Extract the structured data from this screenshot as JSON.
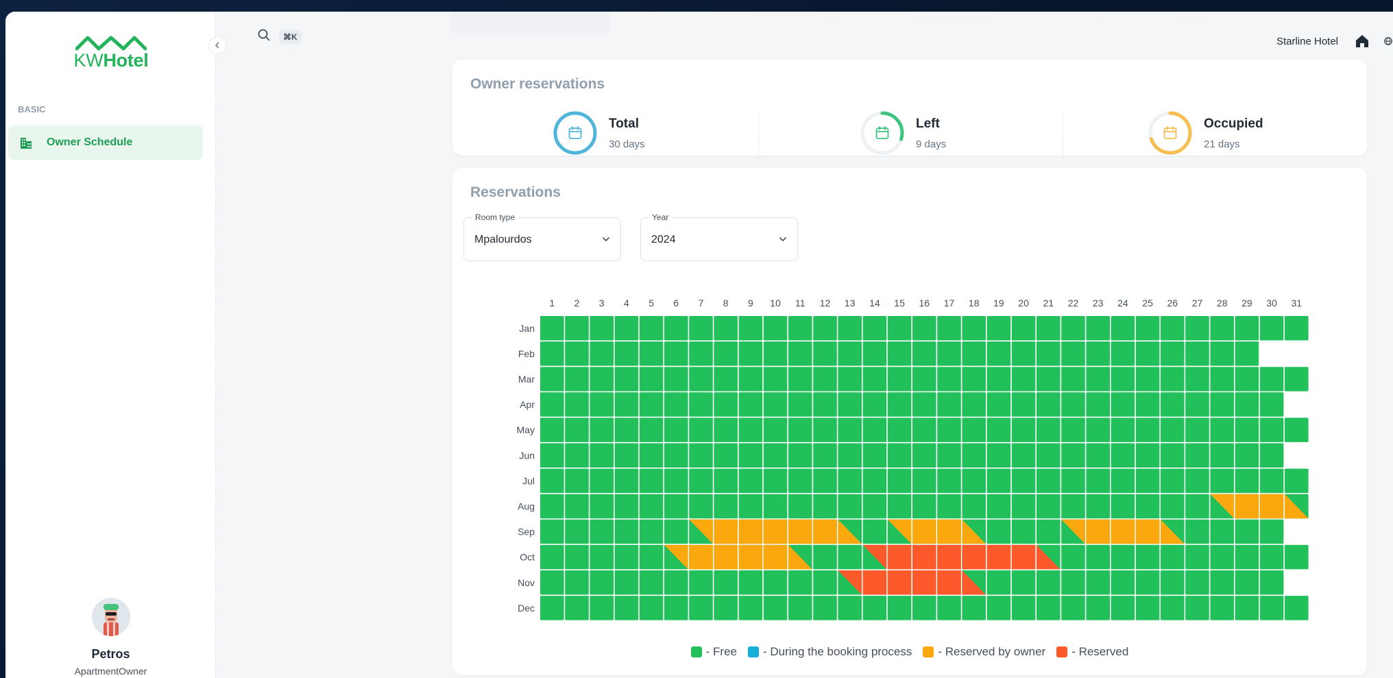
{
  "app": {
    "logo_brand_prefix": "KW",
    "logo_brand_suffix": "Hotel"
  },
  "sidebar": {
    "section_label": "BASIC",
    "items": [
      {
        "label": "Owner Schedule",
        "icon": "building-icon",
        "active": true
      }
    ],
    "collapse_icon": "chevron-left-icon"
  },
  "user": {
    "name": "Petros",
    "role": "ApartmentOwner"
  },
  "topbar": {
    "search_icon": "search-icon",
    "shortcut": "⌘K",
    "hotel_name": "Starline Hotel",
    "home_icon": "home-icon",
    "language_icon": "globe-icon"
  },
  "owner_reservations": {
    "title": "Owner reservations",
    "stats": [
      {
        "label": "Total",
        "value": "30 days",
        "color": "#4fb6d9",
        "progress": 1.0
      },
      {
        "label": "Left",
        "value": "9 days",
        "color": "#3dc47e",
        "progress": 0.3
      },
      {
        "label": "Occupied",
        "value": "21 days",
        "color": "#f5be4f",
        "progress": 0.7
      }
    ]
  },
  "reservations": {
    "title": "Reservations",
    "room_type": {
      "label": "Room type",
      "value": "Mpalourdos"
    },
    "year": {
      "label": "Year",
      "value": "2024"
    },
    "calendar": {
      "months": [
        "Jan",
        "Feb",
        "Mar",
        "Apr",
        "May",
        "Jun",
        "Jul",
        "Aug",
        "Sep",
        "Oct",
        "Nov",
        "Dec"
      ],
      "days_in_month": [
        31,
        29,
        31,
        30,
        31,
        30,
        31,
        31,
        30,
        31,
        30,
        31
      ],
      "days": [
        "1",
        "2",
        "3",
        "4",
        "5",
        "6",
        "7",
        "8",
        "9",
        "10",
        "11",
        "12",
        "13",
        "14",
        "15",
        "16",
        "17",
        "18",
        "19",
        "20",
        "21",
        "22",
        "23",
        "24",
        "25",
        "26",
        "27",
        "28",
        "29",
        "30",
        "31"
      ],
      "colors": {
        "free": "#22c05a",
        "booking": "#16afd8",
        "owner": "#fba80f",
        "reserved": "#fc5a2b"
      },
      "bookings": [
        {
          "type": "owner",
          "start": [
            8,
            28
          ],
          "end": [
            8,
            31
          ]
        },
        {
          "type": "owner",
          "start": [
            9,
            7
          ],
          "end": [
            9,
            13
          ]
        },
        {
          "type": "owner",
          "start": [
            9,
            15
          ],
          "end": [
            9,
            18
          ]
        },
        {
          "type": "owner",
          "start": [
            9,
            22
          ],
          "end": [
            9,
            26
          ]
        },
        {
          "type": "owner",
          "start": [
            10,
            6
          ],
          "end": [
            10,
            11
          ]
        },
        {
          "type": "reserved",
          "start": [
            10,
            14
          ],
          "end": [
            10,
            21
          ]
        },
        {
          "type": "reserved",
          "start": [
            11,
            13
          ],
          "end": [
            11,
            18
          ]
        }
      ]
    },
    "legend": [
      {
        "key": "free",
        "label": "- Free"
      },
      {
        "key": "booking",
        "label": "- During the booking process"
      },
      {
        "key": "owner",
        "label": "- Reserved by owner"
      },
      {
        "key": "reserved",
        "label": "- Reserved"
      }
    ]
  }
}
